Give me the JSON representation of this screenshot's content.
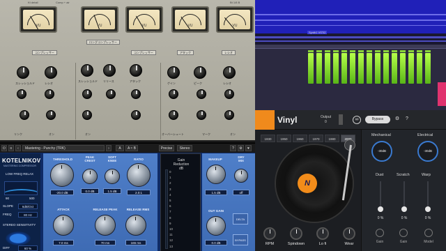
{
  "rack": {
    "header": [
      "",
      "Kt detail",
      "Comp + air",
      "",
      "Bt 1/8 B"
    ],
    "meter_label": "VU",
    "top_labels": [
      "コンプレッサー",
      "ロングコンプレッサー",
      "コンプレッサー",
      "アタック",
      "レシオ"
    ],
    "row_labels": [
      "スレッショルド",
      "レシオ",
      "スレッショルド",
      "リリース",
      "アタック",
      "ゲイン",
      "ピーク",
      "レシオ",
      "アウトプット"
    ],
    "bottom_labels": [
      "リンク",
      "オン",
      "オン",
      "オーバーシュート",
      "マーク",
      "オン"
    ]
  },
  "daw": {
    "clip_title": "Synth1 VSTi2"
  },
  "kotelnikov": {
    "preset": "Mastering - Punchy (TRK)",
    "ab_a": "A",
    "ab_b": "A ≈ B",
    "precise": "Precise",
    "stereo": "Stereo",
    "help": "?",
    "brand": "KOTELNIKOV",
    "brand_sub": "MASTERING COMPRESSOR",
    "low_freq_relax": "LOW FREQ RELAX",
    "lfr_min": "90",
    "lfr_max": "500",
    "slope_label": "SLOPE",
    "slope_value": "6dB/Oct",
    "freq_label": "FREQ",
    "freq_value": "80 Hz",
    "stereo_sens": "STEREO SENSITIVITY",
    "diff_label": "DIFF",
    "diff_value": "60 %",
    "threshold_label": "THRESHOLD",
    "threshold_value": "-20.0 dB",
    "peak_crest_label": "PEAK\nCREST",
    "peak_crest_value": "0.0 dB",
    "soft_knee_label": "SOFT\nKNEE",
    "soft_knee_value": "1.5 dB",
    "ratio_label": "RATIO",
    "ratio_value": "2.0:1",
    "attack_label": "ATTACK",
    "attack_value": "7.0 ms",
    "release_peak_label": "RELEASE PEAK",
    "release_rms_label": "RELEASE RMS",
    "release_peak_value": "70 ms",
    "release_rms_value": "165 ms",
    "gain_reduction_title": "Gain\nReduction\ndB",
    "gr_scale": [
      "0",
      "1",
      "2",
      "3",
      "4",
      "5",
      "6",
      "7",
      "8",
      "9",
      "10",
      "11",
      "12",
      "13"
    ],
    "makeup_label": "MAKEUP",
    "makeup_value": "1.5 dB",
    "dry_label": "DRY\nMIX",
    "dry_value": "off",
    "outgain_label": "OUT GAIN",
    "outgain_value": "0.0 dB",
    "delta": "DELTA",
    "bypass": "BYPASS"
  },
  "vinyl": {
    "title": "Vinyl",
    "output_label": "Output",
    "output_value": "0",
    "bypass": "Bypass",
    "help": "?",
    "years": [
      "1930",
      "1950",
      "1960",
      "1970",
      "1980",
      "2000"
    ],
    "selected_year": "2000",
    "record_label": "N",
    "knobs": [
      "RPM",
      "Spindown",
      "Lo fi",
      "Wear"
    ],
    "mechanical": "Mechanical",
    "electrical": "Electrical",
    "mech_value": "-30dB",
    "elec_value": "-30dB",
    "sliders": [
      "Dust",
      "Scratch",
      "Warp"
    ],
    "slider_values": [
      "0 %",
      "0 %",
      "0 %"
    ],
    "bottom": [
      "Gain",
      "Gain",
      "Model"
    ],
    "accent": "#f08a1c",
    "dial_color": "#3a7ad0"
  },
  "colors": {
    "kot_blue": "#4f7fc9",
    "daw_blue": "#2020b8",
    "clip_green": "#7fe031"
  }
}
